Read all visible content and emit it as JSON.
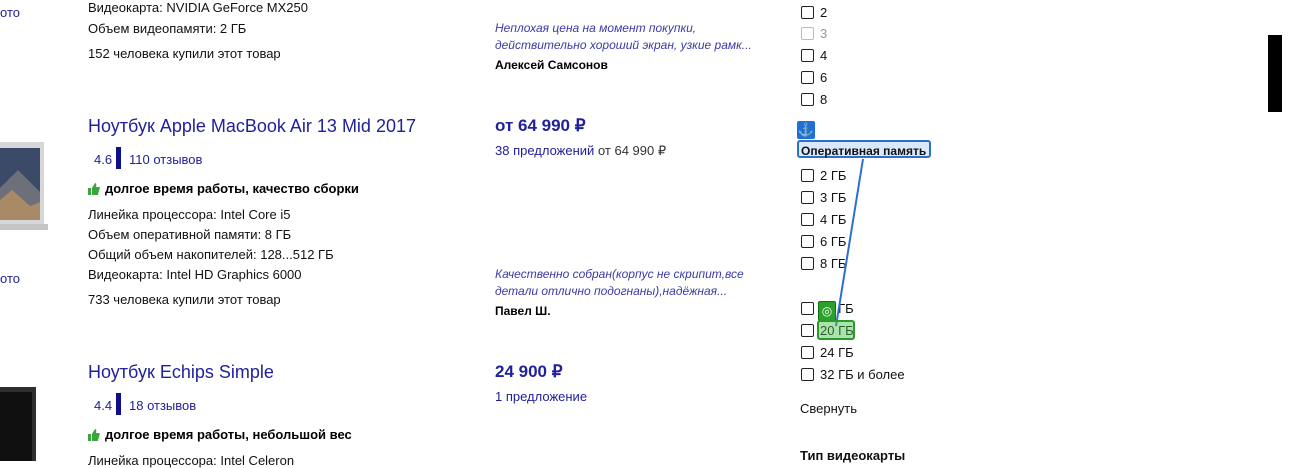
{
  "left_links": [
    "ото",
    "ото"
  ],
  "product_top": {
    "specs": [
      "Видеокарта: NVIDIA GeForce MX250",
      "Объем видеопамяти: 2 ГБ"
    ],
    "buyers": "152 человека купили этот товар",
    "review_text": [
      "Неплохая цена на момент покупки,",
      "действительно хороший экран, узкие рамк..."
    ],
    "review_author": "Алексей Самсонов"
  },
  "product_macbook": {
    "title": "Ноутбук Apple MacBook Air 13 Mid 2017",
    "rating": "4.6",
    "reviews": "110 отзывов",
    "pros": "долгое время работы, качество сборки",
    "specs": [
      "Линейка процессора: Intel Core i5",
      "Объем оперативной памяти: 8 ГБ",
      "Общий объем накопителей: 128...512 ГБ",
      "Видеокарта: Intel HD Graphics 6000"
    ],
    "buyers": "733 человека купили этот товар",
    "price": "от 64 990 ₽",
    "offers_link": "38 предложений",
    "offers_rest": "от 64 990 ₽",
    "review_text": [
      "Качественно собран(корпус не скрипит,все",
      "детали отлично подогнаны),надёжная..."
    ],
    "review_author": "Павел Ш."
  },
  "product_echips": {
    "title": "Ноутбук Echips Simple",
    "rating": "4.4",
    "reviews": "18 отзывов",
    "pros": "долгое время работы, небольшой вес",
    "specs_partial": "Линейка процессора: Intel Celeron",
    "price": "24 900 ₽",
    "offers_link": "1 предложение"
  },
  "filters": {
    "top_options": [
      {
        "label": "2",
        "disabled": false
      },
      {
        "label": "3",
        "disabled": true
      },
      {
        "label": "4",
        "disabled": false
      },
      {
        "label": "6",
        "disabled": false
      },
      {
        "label": "8",
        "disabled": false
      }
    ],
    "ram_title": "Оперативная память",
    "ram_options": [
      "2 ГБ",
      "3 ГБ",
      "4 ГБ",
      "6 ГБ",
      "8 ГБ",
      "12 ГБ",
      "20 ГБ",
      "24 ГБ",
      "32 ГБ и более"
    ],
    "collapse": "Свернуть",
    "gpu_title": "Тип видеокарты"
  },
  "overlay": {
    "anchor_icon": "anchor-icon",
    "target_icon": "target-icon"
  }
}
